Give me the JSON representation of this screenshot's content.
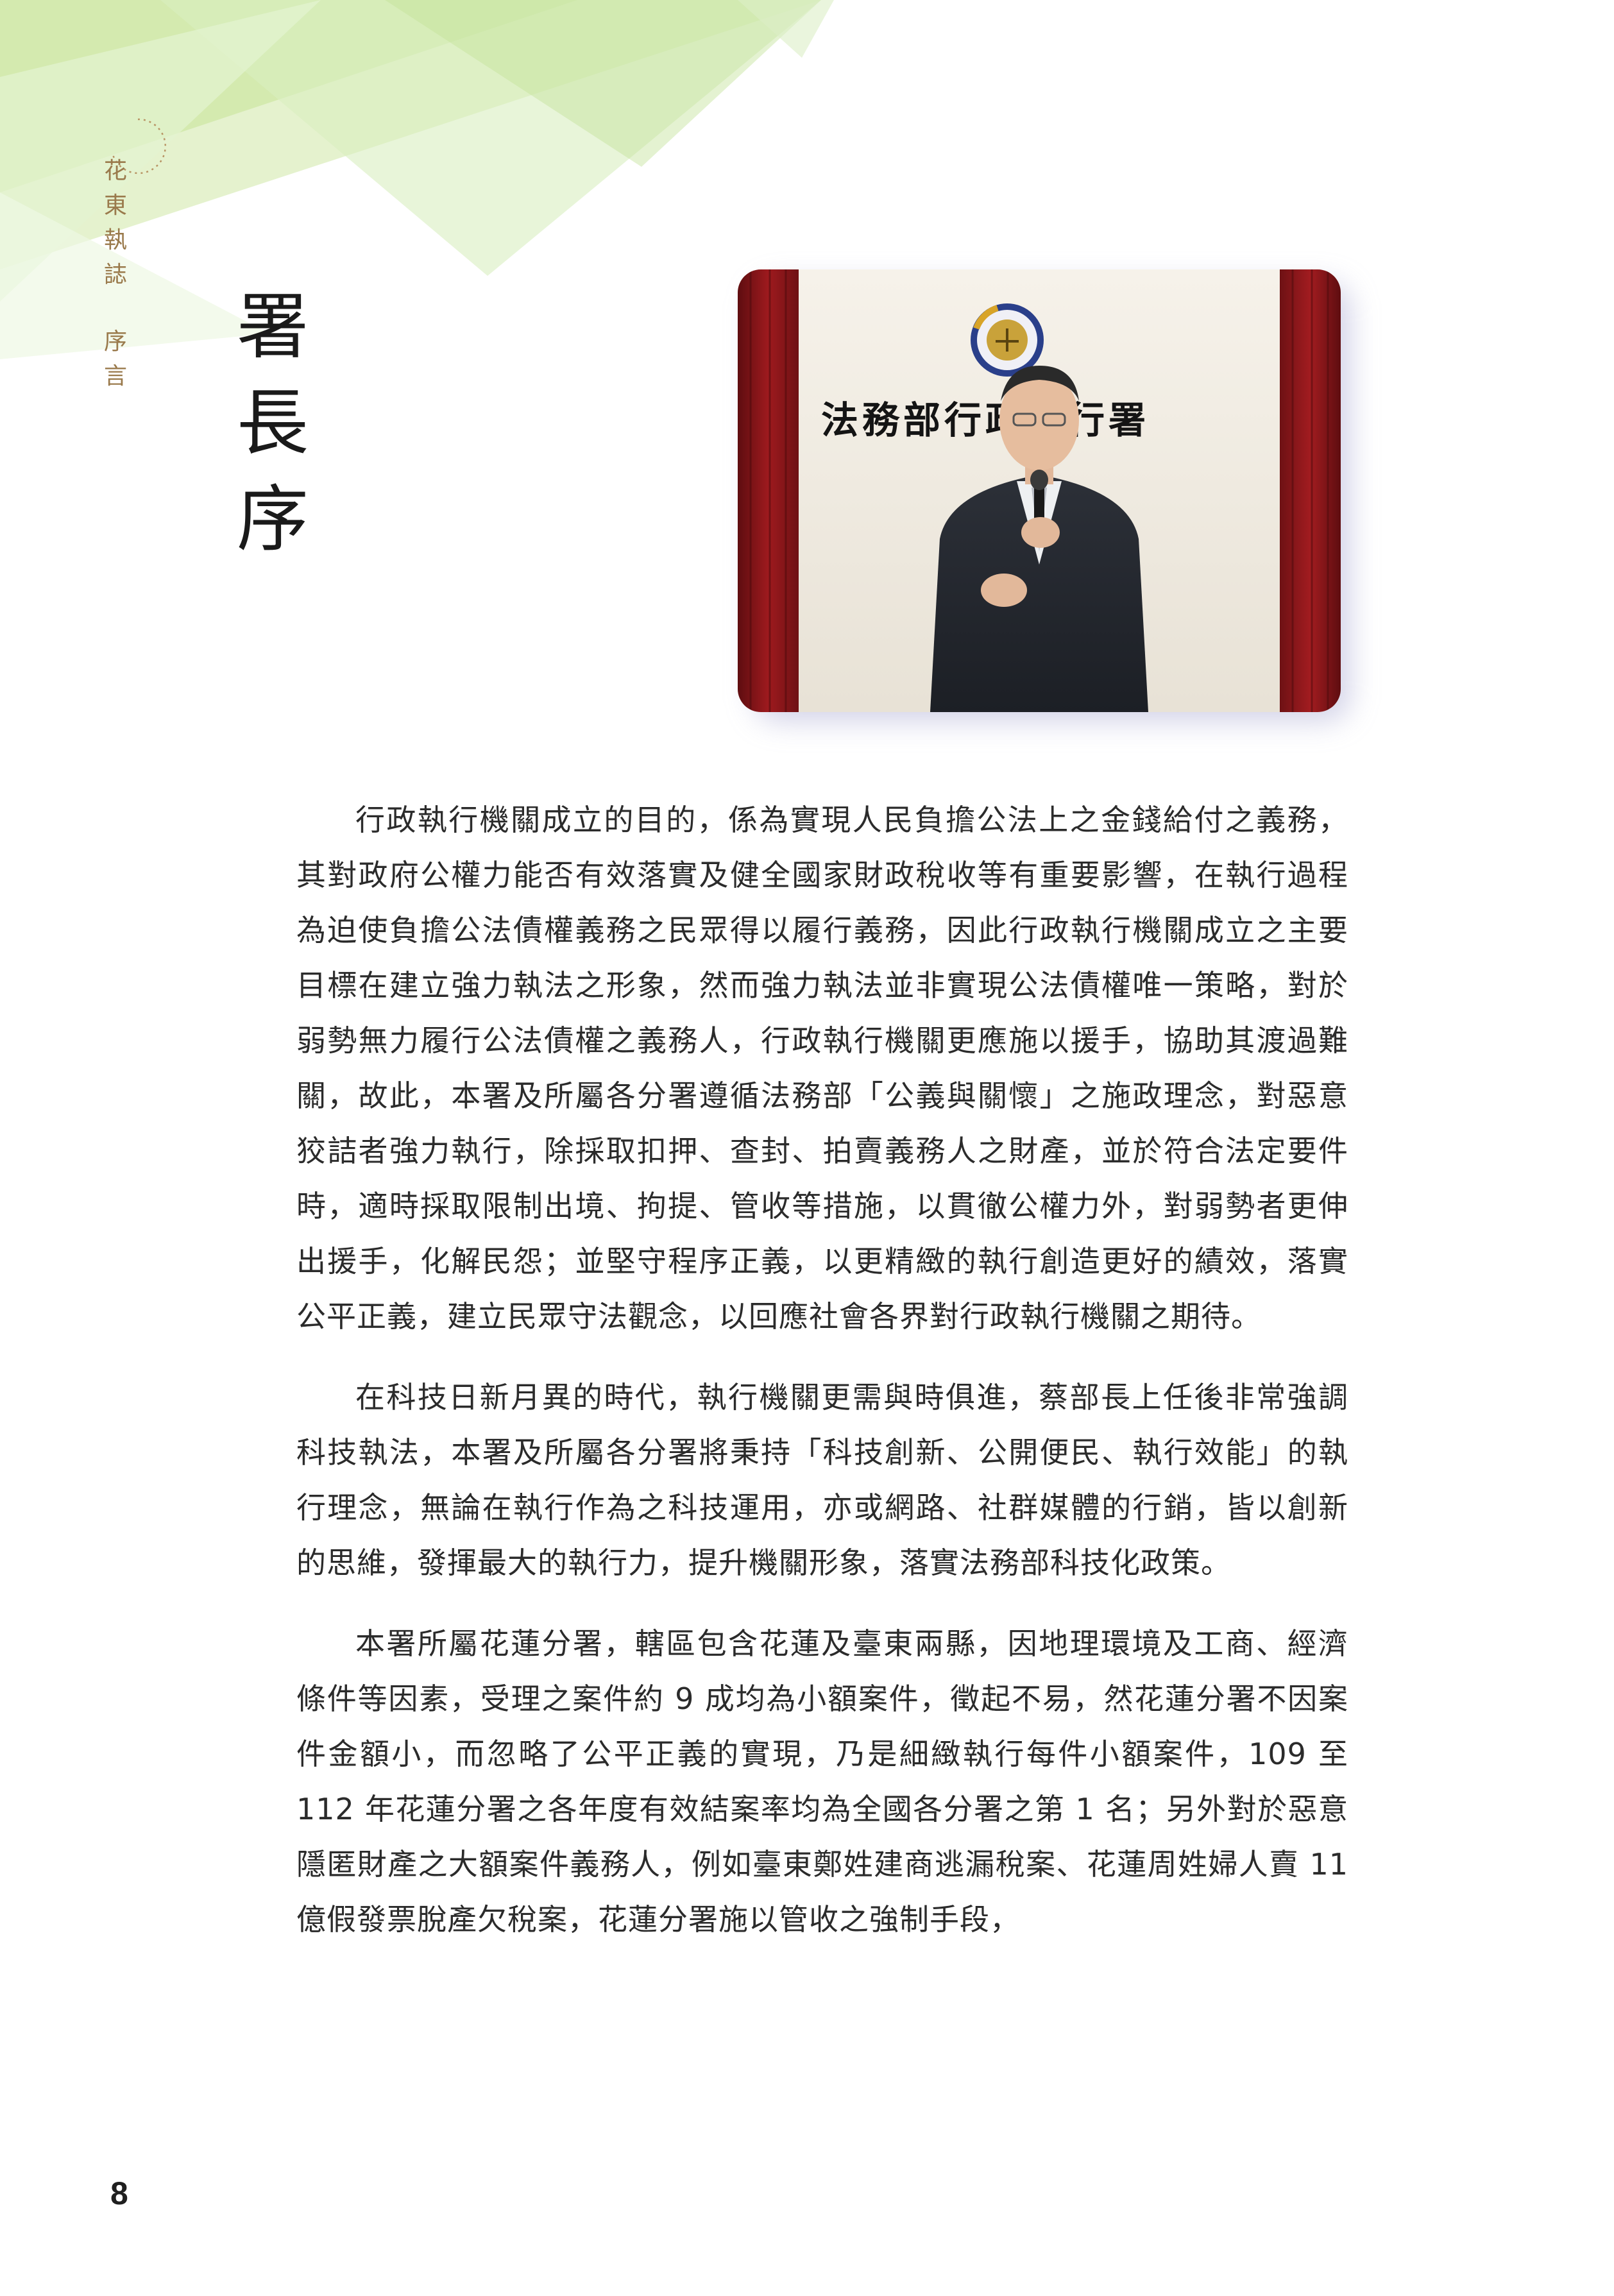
{
  "side_label": {
    "chars": [
      "花",
      "東",
      "執",
      "誌"
    ],
    "section_chars": [
      "序",
      "言"
    ]
  },
  "title": {
    "chars": [
      "署",
      "長",
      "序"
    ]
  },
  "photo": {
    "sign_text": "法務部行政執行署"
  },
  "paragraphs": [
    "行政執行機關成立的目的，係為實現人民負擔公法上之金錢給付之義務，其對政府公權力能否有效落實及健全國家財政稅收等有重要影響，在執行過程為迫使負擔公法債權義務之民眾得以履行義務，因此行政執行機關成立之主要目標在建立強力執法之形象，然而強力執法並非實現公法債權唯一策略，對於弱勢無力履行公法債權之義務人，行政執行機關更應施以援手，協助其渡過難關，故此，本署及所屬各分署遵循法務部「公義與關懷」之施政理念，對惡意狡詰者強力執行，除採取扣押、查封、拍賣義務人之財產，並於符合法定要件時，適時採取限制出境、拘提、管收等措施，以貫徹公權力外，對弱勢者更伸出援手，化解民怨；並堅守程序正義，以更精緻的執行創造更好的績效，落實公平正義，建立民眾守法觀念，以回應社會各界對行政執行機關之期待。",
    "在科技日新月異的時代，執行機關更需與時俱進，蔡部長上任後非常強調科技執法，本署及所屬各分署將秉持「科技創新、公開便民、執行效能」的執行理念，無論在執行作為之科技運用，亦或網路、社群媒體的行銷，皆以創新的思維，發揮最大的執行力，提升機關形象，落實法務部科技化政策。",
    "本署所屬花蓮分署，轄區包含花蓮及臺東兩縣，因地理環境及工商、經濟條件等因素，受理之案件約 9 成均為小額案件，徵起不易，然花蓮分署不因案件金額小，而忽略了公平正義的實現，乃是細緻執行每件小額案件，109 至 112 年花蓮分署之各年度有效結案率均為全國各分署之第 1 名；另外對於惡意隱匿財產之大額案件義務人，例如臺東鄭姓建商逃漏稅案、花蓮周姓婦人賣 11 億假發票脫產欠稅案，花蓮分署施以管收之強制手段，"
  ],
  "page_number": "8"
}
